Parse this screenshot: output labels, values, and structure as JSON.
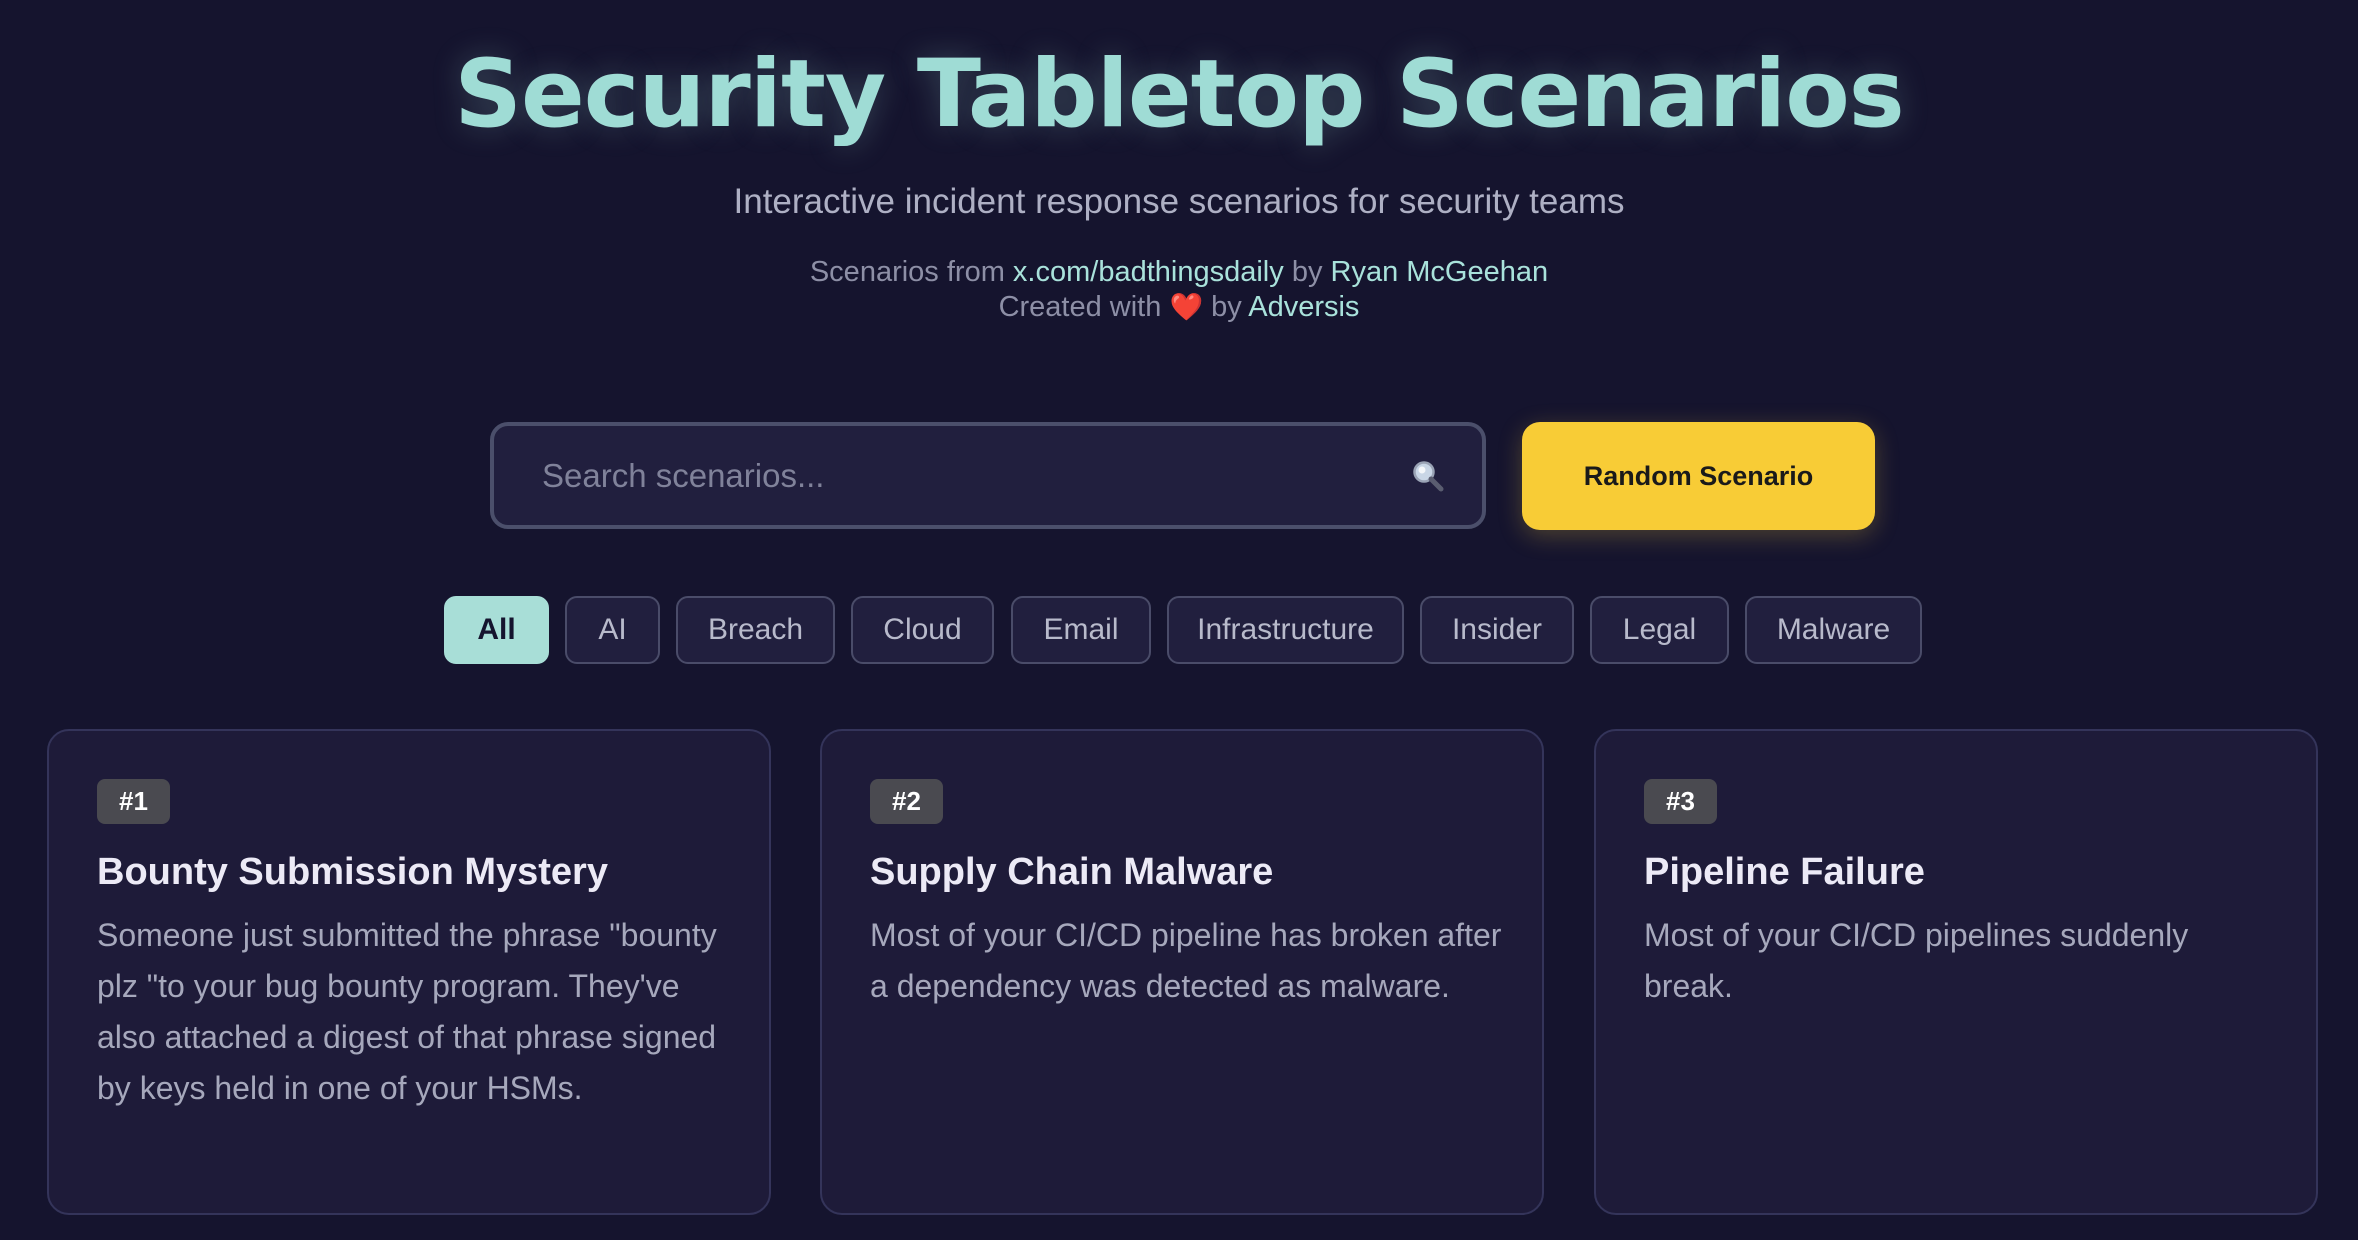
{
  "header": {
    "title": "Security Tabletop Scenarios",
    "subtitle": "Interactive incident response scenarios for security teams",
    "credit1_prefix": "Scenarios from",
    "credit1_link": "x.com/badthingsdaily",
    "credit1_by": "by",
    "credit1_author": "Ryan McGeehan",
    "credit2_prefix": "Created with",
    "credit2_heart": "❤️",
    "credit2_by": "by",
    "credit2_author": "Adversis"
  },
  "search": {
    "placeholder": "Search scenarios...",
    "value": "",
    "icon": "search-icon"
  },
  "random_button": {
    "label": "Random Scenario",
    "color": "#f8cc36"
  },
  "filters": [
    {
      "label": "All",
      "active": true
    },
    {
      "label": "AI",
      "active": false
    },
    {
      "label": "Breach",
      "active": false
    },
    {
      "label": "Cloud",
      "active": false
    },
    {
      "label": "Email",
      "active": false
    },
    {
      "label": "Infrastructure",
      "active": false
    },
    {
      "label": "Insider",
      "active": false
    },
    {
      "label": "Legal",
      "active": false
    },
    {
      "label": "Malware",
      "active": false
    }
  ],
  "scenarios": [
    {
      "badge": "#1",
      "title": "Bounty Submission Mystery",
      "description": "Someone just submitted the phrase \"bounty plz \"to your bug bounty program. They've also attached a digest of that phrase signed by keys held in one of your HSMs."
    },
    {
      "badge": "#2",
      "title": "Supply Chain Malware",
      "description": "Most of your CI/CD pipeline has broken after a dependency was detected as malware."
    },
    {
      "badge": "#3",
      "title": "Pipeline Failure",
      "description": "Most of your CI/CD pipelines suddenly break."
    }
  ],
  "colors": {
    "background": "#15142e",
    "accent": "#9fdcd5",
    "card": "#1e1b39",
    "button": "#f8cc36"
  }
}
